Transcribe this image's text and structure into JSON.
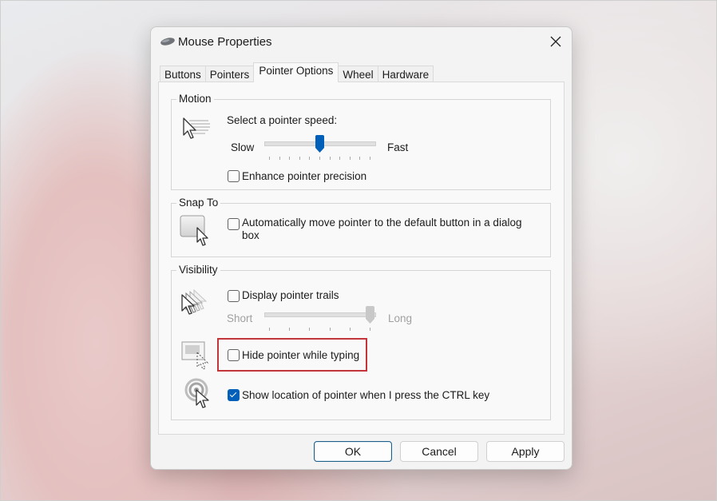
{
  "window": {
    "title": "Mouse Properties",
    "icon": "mouse-icon",
    "close_icon": "close-icon"
  },
  "tabs": [
    {
      "label": "Buttons",
      "active": false
    },
    {
      "label": "Pointers",
      "active": false
    },
    {
      "label": "Pointer Options",
      "active": true
    },
    {
      "label": "Wheel",
      "active": false
    },
    {
      "label": "Hardware",
      "active": false
    }
  ],
  "motion": {
    "group_label": "Motion",
    "icon": "pointer-speed-icon",
    "speed_label": "Select a pointer speed:",
    "slow_label": "Slow",
    "fast_label": "Fast",
    "speed_value_percent": 50,
    "speed_tick_count": 11,
    "enhance_precision_label": "Enhance pointer precision",
    "enhance_precision_checked": false
  },
  "snap_to": {
    "group_label": "Snap To",
    "icon": "snap-to-button-icon",
    "auto_move_label_line1": "Automatically move pointer to the default button in a dialog",
    "auto_move_label_line2": "box",
    "auto_move_checked": false
  },
  "visibility": {
    "group_label": "Visibility",
    "trails_icon": "pointer-trails-icon",
    "trails_label": "Display pointer trails",
    "trails_checked": false,
    "short_label": "Short",
    "long_label": "Long",
    "trails_value_percent": 100,
    "trails_tick_count": 6,
    "trails_slider_enabled": false,
    "hide_icon": "hide-pointer-icon",
    "hide_while_typing_label": "Hide pointer while typing",
    "hide_while_typing_checked": false,
    "hide_while_typing_highlighted": true,
    "highlight_color": "#c4343b",
    "ctrl_icon": "pointer-location-icon",
    "show_location_label": "Show location of pointer when I press the CTRL key",
    "show_location_checked": true
  },
  "buttons": {
    "ok": "OK",
    "cancel": "Cancel",
    "apply": "Apply"
  },
  "colors": {
    "accent": "#005fb8"
  }
}
